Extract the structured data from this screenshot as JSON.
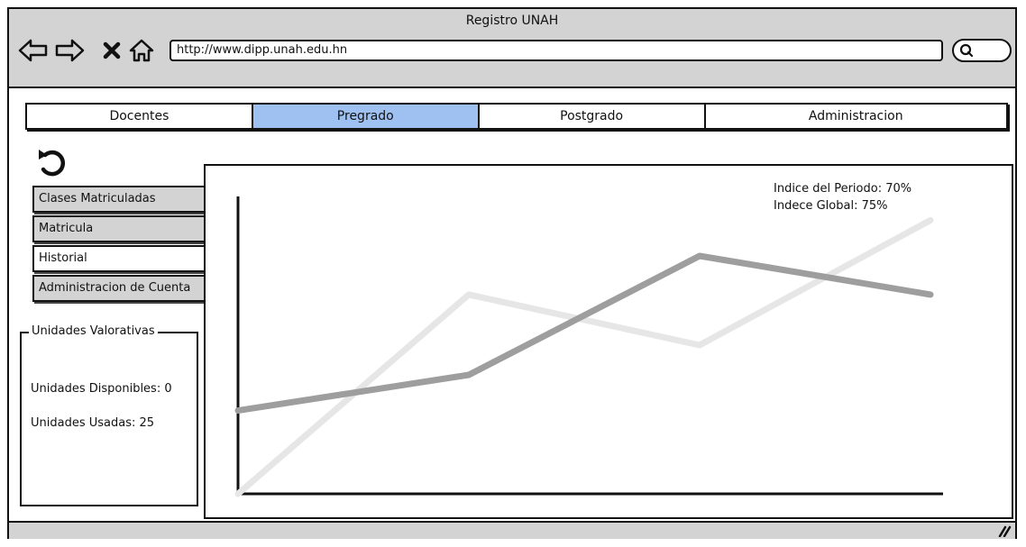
{
  "window": {
    "title": "Registro UNAH",
    "url": "http://www.dipp.unah.edu.hn"
  },
  "toolbar": {
    "icons": [
      "back-arrow-icon",
      "forward-arrow-icon",
      "close-icon",
      "home-icon",
      "search-icon"
    ]
  },
  "tabs": [
    {
      "label": "Docentes",
      "active": false
    },
    {
      "label": "Pregrado",
      "active": true
    },
    {
      "label": "Postgrado",
      "active": false
    },
    {
      "label": "Administracion",
      "active": false
    }
  ],
  "sidebar": {
    "refresh_icon": "refresh-icon",
    "items": [
      {
        "label": "Clases Matriculadas",
        "active": false
      },
      {
        "label": "Matricula",
        "active": false
      },
      {
        "label": "Historial",
        "active": true
      },
      {
        "label": "Administracion de Cuenta",
        "active": false
      }
    ]
  },
  "units": {
    "legend": "Unidades Valorativas",
    "available": "Unidades Disponibles: 0",
    "used": "Unidades Usadas: 25"
  },
  "chart": {
    "period_index": "Indice del Periodo: 70%",
    "global_index": "Indece Global: 75%"
  },
  "chart_data": {
    "type": "line",
    "x": [
      1,
      2,
      3,
      4
    ],
    "ylim": [
      0,
      100
    ],
    "series": [
      {
        "values": [
          28,
          40,
          80,
          67
        ],
        "color": "#9e9e9e"
      },
      {
        "values": [
          0,
          67,
          50,
          92
        ],
        "color": "#e6e6e6"
      }
    ]
  },
  "colors": {
    "active_tab": "#9ec1f2",
    "chrome": "#d3d3d3"
  }
}
